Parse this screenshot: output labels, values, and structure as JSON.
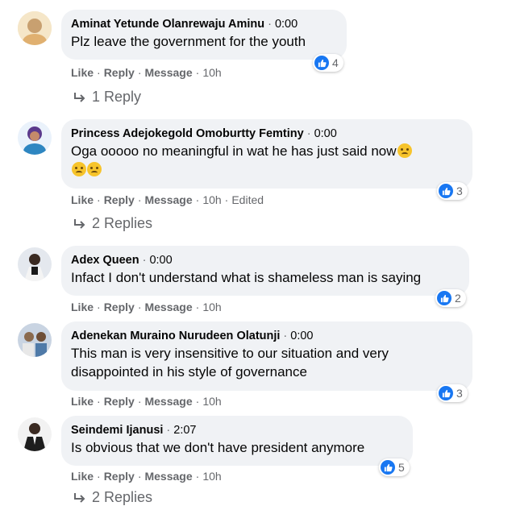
{
  "comments": [
    {
      "name": "Aminat Yetunde Olanrewaju Aminu",
      "time": "0:00",
      "text": "Plz leave the government for the youth",
      "reactions": "4",
      "actions": {
        "like": "Like",
        "reply": "Reply",
        "message": "Message",
        "age": "10h"
      },
      "replies": "1 Reply",
      "avatar_colors": [
        "#f5d9a8",
        "#c8a070"
      ]
    },
    {
      "name": "Princess Adejokegold Omoburtty Femtiny",
      "time": "0:00",
      "text": "Oga ooooo no meaningful in wat he has just said now",
      "reactions": "3",
      "actions": {
        "like": "Like",
        "reply": "Reply",
        "message": "Message",
        "age": "10h",
        "edited": "Edited"
      },
      "replies": "2 Replies",
      "avatar_colors": [
        "#2e86c1",
        "#e6a0c4"
      ]
    },
    {
      "name": "Adex Queen",
      "time": "0:00",
      "text": "Infact I don't understand what is shameless man is saying",
      "reactions": "2",
      "actions": {
        "like": "Like",
        "reply": "Reply",
        "message": "Message",
        "age": "10h"
      },
      "avatar_colors": [
        "#dfe3ea",
        "#2b2b2b"
      ]
    },
    {
      "name": "Adenekan Muraino Nurudeen Olatunji",
      "time": "0:00",
      "text_line1": "This man is very insensitive to our situation and very",
      "text_line2": "disappointed in his style of governance",
      "reactions": "3",
      "actions": {
        "like": "Like",
        "reply": "Reply",
        "message": "Message",
        "age": "10h"
      },
      "avatar_colors": [
        "#b9c6d6",
        "#8a6a4e"
      ]
    },
    {
      "name": "Seindemi Ijanusi",
      "time": "2:07",
      "text": "Is obvious that we don't have president anymore",
      "reactions": "5",
      "actions": {
        "like": "Like",
        "reply": "Reply",
        "message": "Message",
        "age": "10h"
      },
      "replies": "2 Replies",
      "avatar_colors": [
        "#3a3a3a",
        "#f2f2f2"
      ]
    }
  ],
  "colors": {
    "bubble": "#f0f2f5",
    "like_blue": "#1877f2",
    "meta_gray": "#65676b"
  },
  "icons": {
    "like": "thumbs-up-icon",
    "reply": "reply-arrow-icon",
    "emoji": "confused-face-emoji"
  }
}
